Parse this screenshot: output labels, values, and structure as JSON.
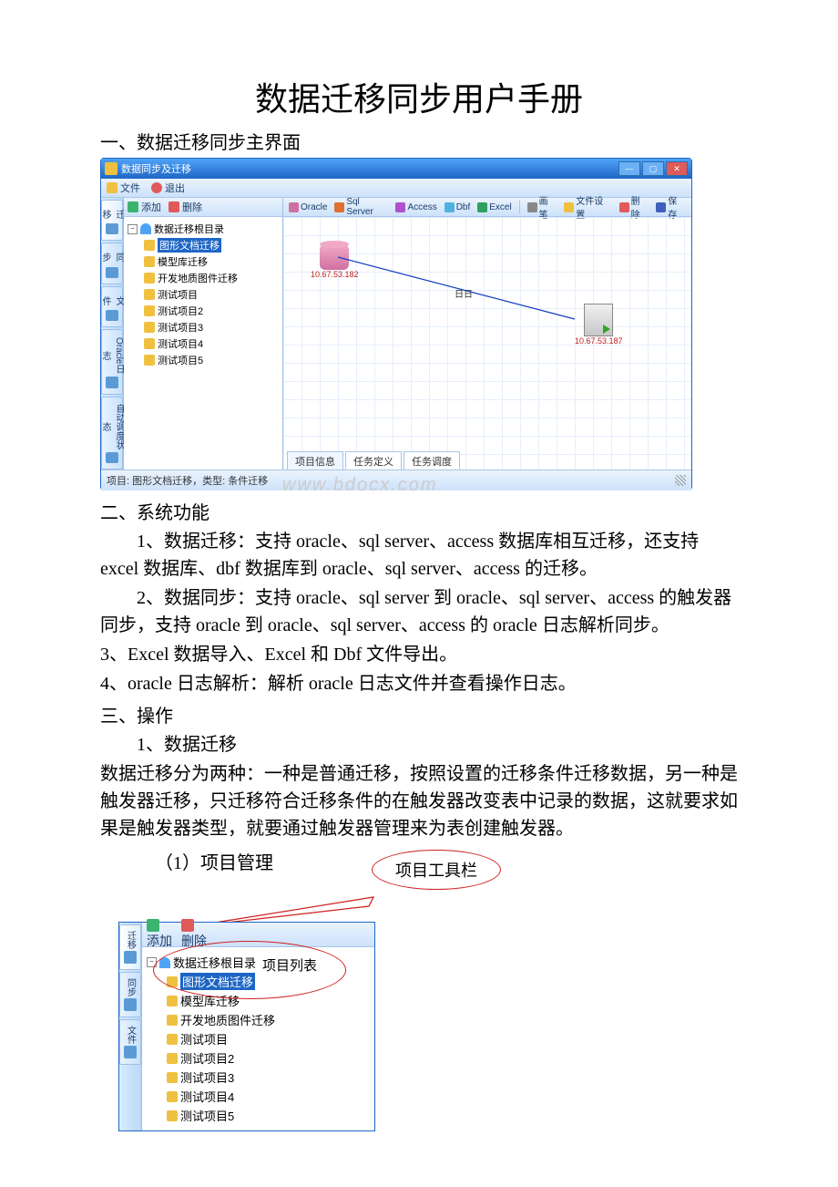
{
  "doc": {
    "title": "数据迁移同步用户手册",
    "sec1": "一、数据迁移同步主界面",
    "sec2": "二、系统功能",
    "sec2_p1": "1、数据迁移：支持 oracle、sql server、access 数据库相互迁移，还支持 excel 数据库、dbf 数据库到 oracle、sql server、access 的迁移。",
    "sec2_p2": "2、数据同步：支持 oracle、sql server 到 oracle、sql server、access 的触发器同步，支持 oracle 到 oracle、sql server、access 的 oracle  日志解析同步。",
    "sec2_p3": "3、Excel 数据导入、Excel 和 Dbf 文件导出。",
    "sec2_p4": "4、oracle 日志解析：解析 oracle 日志文件并查看操作日志。",
    "sec3": "三、操作",
    "sec3_p1": "1、数据迁移",
    "sec3_p2": "数据迁移分为两种：一种是普通迁移，按照设置的迁移条件迁移数据，另一种是触发器迁移，只迁移符合迁移条件的在触发器改变表中记录的数据，这就要求如果是触发器类型，就要通过触发器管理来为表创建触发器。",
    "sec3_sub1": "（1）项目管理",
    "callout_toolbar": "项目工具栏",
    "callout_list": "项目列表",
    "watermark": "www.bdocx.com"
  },
  "win": {
    "title": "数据同步及迁移",
    "menu_file": "文件",
    "menu_exit": "退出",
    "side": {
      "t1": "迁移",
      "t2": "同步",
      "t3": "文件",
      "t4": "Oracle日志",
      "t5": "自动调度状态"
    },
    "toolbar": {
      "add": "添加",
      "del": "删除"
    },
    "tree": {
      "root": "数据迁移根目录",
      "items": [
        "图形文档迁移",
        "模型库迁移",
        "开发地质图件迁移",
        "测试项目",
        "测试项目2",
        "测试项目3",
        "测试项目4",
        "测试项目5"
      ]
    },
    "canvas_tb": {
      "oracle": "Oracle",
      "sqlserver": "Sql Server",
      "access": "Access",
      "dbf": "Dbf",
      "excel": "Excel",
      "brush": "画笔",
      "docset": "文件设置",
      "del": "删除",
      "save": "保存"
    },
    "nodes": {
      "ip1": "10.67.53.182",
      "ip2": "10.67.53.187"
    },
    "midmark": "日日",
    "tabs": {
      "t1": "项目信息",
      "t2": "任务定义",
      "t3": "任务调度"
    },
    "status": "项目: 图形文档迁移，类型: 条件迁移"
  }
}
